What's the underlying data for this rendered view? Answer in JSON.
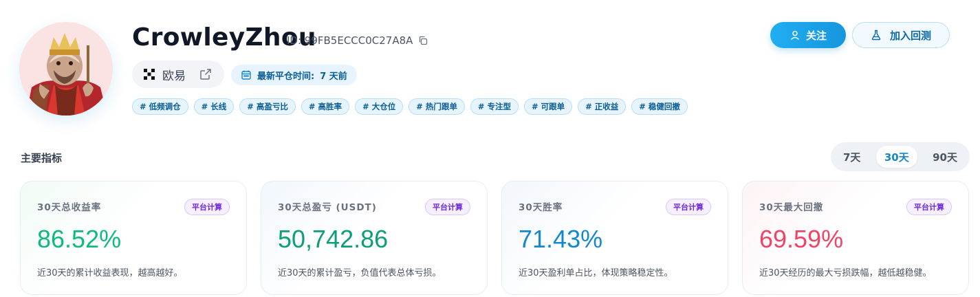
{
  "profile": {
    "username": "CrowleyZhou",
    "id_text": "ID: 99FB5ECCC0C27A8A",
    "exchange": "欧易",
    "last_close_label": "最新平仓时间:",
    "last_close_value": "7 天前",
    "tags": [
      "# 低频调仓",
      "# 长线",
      "# 高盈亏比",
      "# 高胜率",
      "# 大仓位",
      "# 热门跟单",
      "# 专注型",
      "# 可跟单",
      "# 正收益",
      "# 稳健回撤"
    ]
  },
  "actions": {
    "follow_label": "关注",
    "backtest_label": "加入回测"
  },
  "metrics_section": {
    "title": "主要指标",
    "periods": [
      "7天",
      "30天",
      "90天"
    ],
    "active_period": "30天"
  },
  "cards": [
    {
      "label": "30天总收益率",
      "badge": "平台计算",
      "value": "86.52%",
      "desc": "近30天的累计收益表现，越高越好。",
      "color": "#10b981"
    },
    {
      "label": "30天总盈亏 (USDT)",
      "badge": "平台计算",
      "value": "50,742.86",
      "desc": "近30天的累计盈亏，负值代表总体亏损。",
      "color": "#0f9e78"
    },
    {
      "label": "30天胜率",
      "badge": "平台计算",
      "value": "71.43%",
      "desc": "近30天盈利单占比，体现策略稳定性。",
      "color": "#1487cf"
    },
    {
      "label": "30天最大回撤",
      "badge": "平台计算",
      "value": "69.59%",
      "desc": "近30天经历的最大亏损跌幅，越低越稳健。",
      "color": "#ef4565"
    }
  ],
  "icons": {
    "copy": "copy-icon",
    "exchange_logo": "okx-logo-icon",
    "external": "external-link-icon",
    "calendar": "calendar-icon",
    "user": "user-icon",
    "flask": "flask-icon"
  }
}
